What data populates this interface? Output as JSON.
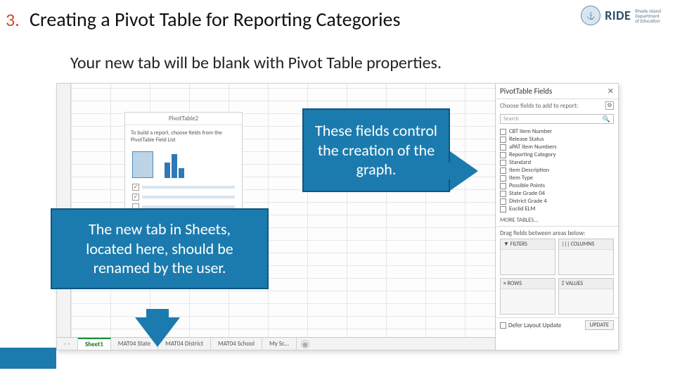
{
  "slide": {
    "number": "3.",
    "heading": "Creating a Pivot Table for Reporting Categories"
  },
  "logo": {
    "ride": "RIDE",
    "sub1": "Rhode Island",
    "sub2": "Department",
    "sub3": "of Education"
  },
  "subheading": "Your new tab will be blank with Pivot Table properties.",
  "pt_placeholder": {
    "title": "PivotTable2",
    "text": "To build a report, choose fields from the PivotTable Field List"
  },
  "ptf": {
    "title": "PivotTable Fields",
    "close": "✕",
    "choose": "Choose fields to add to report:",
    "search": "Search",
    "fields": [
      "CBT Item Number",
      "Release Status",
      "aPAT Item Numbers",
      "Reporting Category",
      "Standard",
      "Item Description",
      "Item Type",
      "Possible Points",
      "State Grade 04",
      "District Grade 4",
      "Euclid ELM"
    ],
    "more": "MORE TABLES...",
    "drag": "Drag fields between areas below:",
    "areas": {
      "filters": "▼ FILTERS",
      "columns": "|||  COLUMNS",
      "rows": "≡  ROWS",
      "values": "Σ  VALUES"
    },
    "defer": "Defer Layout Update",
    "update": "UPDATE"
  },
  "tabs": {
    "nav": "‹ ›",
    "items": [
      "Sheet1",
      "MAT04 State",
      "MAT04 District",
      "MAT04 School",
      "My Sc…"
    ],
    "plus": "⊕"
  },
  "callouts": {
    "c1": "The new tab in Sheets, located here, should be renamed by the user.",
    "c2": "These fields control the creation of the graph."
  }
}
